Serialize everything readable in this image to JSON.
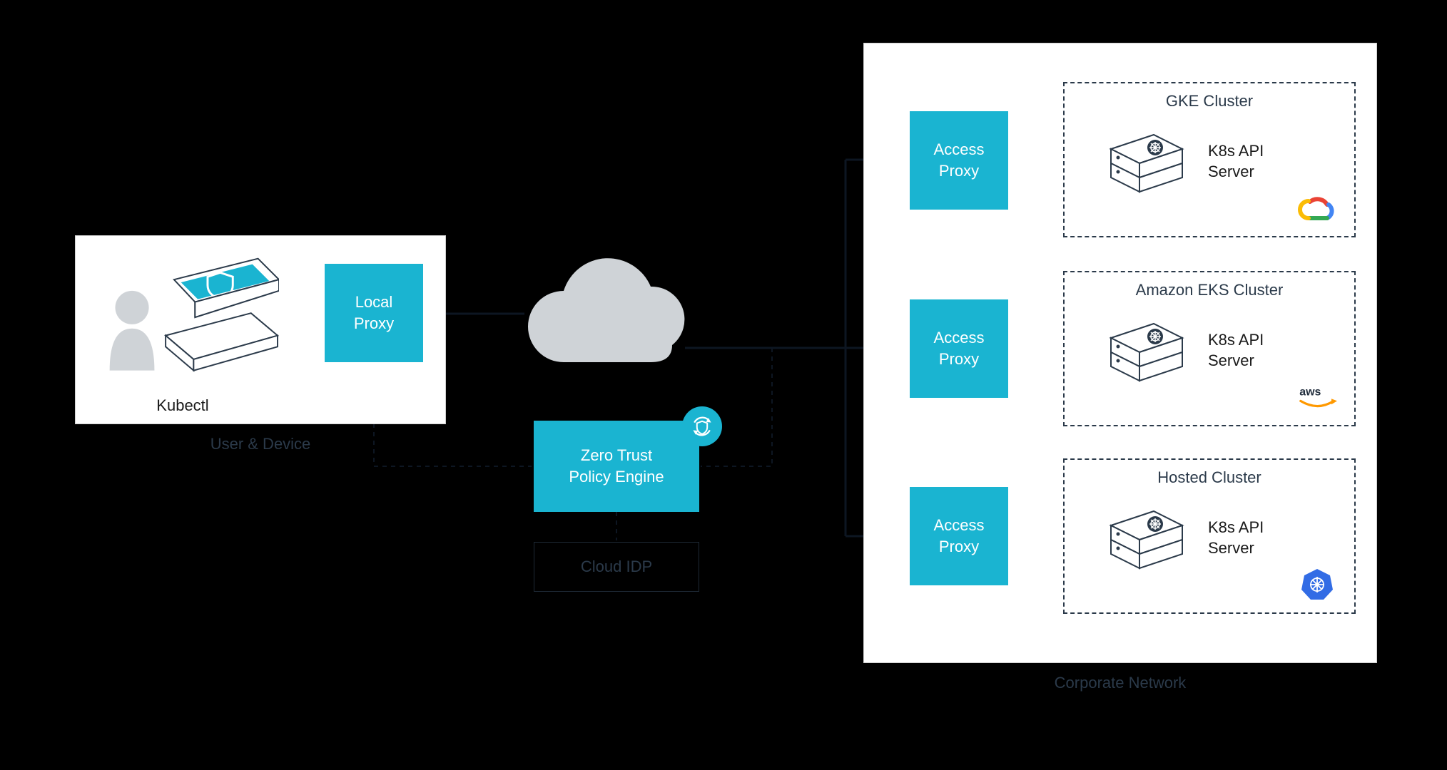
{
  "user_device": {
    "panel_label": "User & Device",
    "kubectl_label": "Kubectl",
    "local_proxy_label": "Local\nProxy"
  },
  "center": {
    "policy_engine_label": "Zero Trust\nPolicy Engine",
    "cloud_idp_label": "Cloud IDP",
    "policy_badge_icon": "sync-shield-icon"
  },
  "corporate": {
    "panel_label": "Corporate Network",
    "access_proxy_label": "Access\nProxy",
    "clusters": [
      {
        "title": "GKE Cluster",
        "api_label": "K8s API\nServer",
        "provider": "gcp"
      },
      {
        "title": "Amazon EKS Cluster",
        "api_label": "K8s API\nServer",
        "provider": "aws"
      },
      {
        "title": "Hosted Cluster",
        "api_label": "K8s API\nServer",
        "provider": "k8s"
      }
    ]
  },
  "colors": {
    "teal": "#1ab4d1",
    "ink": "#2b3a4a",
    "cloud": "#cfd3d7"
  }
}
